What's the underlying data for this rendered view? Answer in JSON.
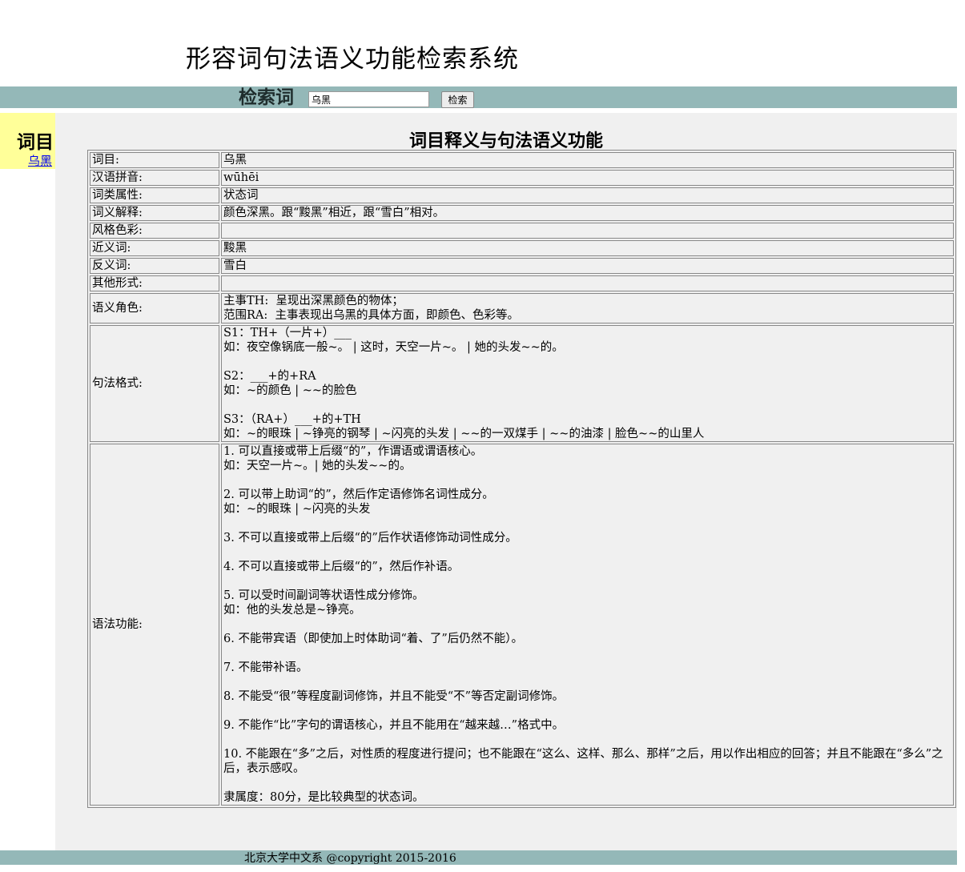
{
  "header": {
    "title": "形容词句法语义功能检索系统"
  },
  "search": {
    "label": "检索词",
    "value": "乌黑",
    "button": "检索"
  },
  "sidebar": {
    "title": "词目",
    "link": "乌黑"
  },
  "main": {
    "title": "词目释义与句法语义功能",
    "rows": [
      {
        "label": "词目:",
        "value": "乌黑"
      },
      {
        "label": "汉语拼音:",
        "value": "wūhēi"
      },
      {
        "label": "词类属性:",
        "value": "状态词"
      },
      {
        "label": "词义解释:",
        "value": "颜色深黑。跟“黢黑”相近，跟“雪白”相对。"
      },
      {
        "label": "风格色彩:",
        "value": ""
      },
      {
        "label": "近义词:",
        "value": "黢黑"
      },
      {
        "label": "反义词:",
        "value": "雪白"
      },
      {
        "label": "其他形式:",
        "value": ""
      },
      {
        "label": "语义角色:",
        "value": "主事TH:  呈现出深黑颜色的物体；\n范围RA:  主事表现出乌黑的具体方面，即颜色、色彩等。"
      },
      {
        "label": "句法格式:",
        "value": "S1：TH+（一片+）___\n如：夜空像锅底一般~。 | 这时，天空一片~。 | 她的头发~~的。\n\nS2：___+的+RA\n如：~的颜色 | ~~的脸色\n\nS3：（RA+）___+的+TH\n如：~的眼珠 | ~铮亮的钢琴 | ~闪亮的头发 | ~~的一双煤手 | ~~的油漆 | 脸色~~的山里人"
      },
      {
        "label": "语法功能:",
        "value": "1. 可以直接或带上后缀“的”，作谓语或谓语核心。\n如：天空一片~。| 她的头发~~的。\n\n2. 可以带上助词“的”，然后作定语修饰名词性成分。\n如：~的眼珠 | ~闪亮的头发\n\n3. 不可以直接或带上后缀“的”后作状语修饰动词性成分。\n\n4. 不可以直接或带上后缀“的”，然后作补语。\n\n5. 可以受时间副词等状语性成分修饰。\n如：他的头发总是~铮亮。\n\n6. 不能带宾语（即使加上时体助词“着、了”后仍然不能）。\n\n7. 不能带补语。\n\n8. 不能受“很”等程度副词修饰，并且不能受“不”等否定副词修饰。\n\n9. 不能作“比”字句的谓语核心，并且不能用在“越来越…”格式中。\n\n10. 不能跟在“多”之后，对性质的程度进行提问；也不能跟在“这么、这样、那么、那样”之后，用以作出相应的回答；并且不能跟在“多么”之后，表示感叹。\n\n隶属度：80分，是比较典型的状态词。"
      }
    ]
  },
  "footer": {
    "text": "北京大学中文系 @copyright 2015-2016"
  },
  "colors": {
    "bar": "#94b8b8",
    "sidebar": "#ffff99",
    "panel": "#f0f0f0",
    "link": "#0000ee"
  }
}
